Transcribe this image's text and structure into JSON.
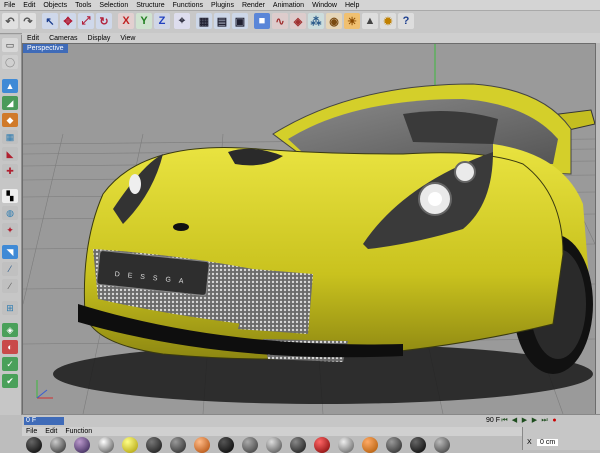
{
  "menu": [
    "File",
    "Edit",
    "Objects",
    "Tools",
    "Selection",
    "Structure",
    "Functions",
    "Plugins",
    "Render",
    "Animation",
    "Window",
    "Help"
  ],
  "viewport_menu": [
    "Edit",
    "Cameras",
    "Display",
    "View"
  ],
  "viewport": {
    "title": "Perspective",
    "plate_text": "DESSGA"
  },
  "timeline": {
    "current_frame": "0 F",
    "end_frame": "90 F"
  },
  "material_menu": [
    "File",
    "Edit",
    "Function"
  ],
  "coords": {
    "x_label": "X",
    "x_value": "0 cm"
  },
  "colors": {
    "car_body": "#d7d22a",
    "viewport_bg": "#9a9a9a",
    "selection_blue": "#3f6bb8"
  },
  "icons": [
    "undo-icon",
    "redo-icon",
    "select-icon",
    "move-icon",
    "scale-icon",
    "rotate-icon",
    "x-axis-icon",
    "y-axis-icon",
    "z-axis-icon",
    "world-icon",
    "render-view-icon",
    "render-pv-icon",
    "render-settings-icon",
    "cube-icon",
    "spline-icon",
    "nurbs-icon",
    "array-icon",
    "camera-icon",
    "light-icon",
    "scene-icon",
    "light-bulb-icon",
    "question-icon"
  ]
}
